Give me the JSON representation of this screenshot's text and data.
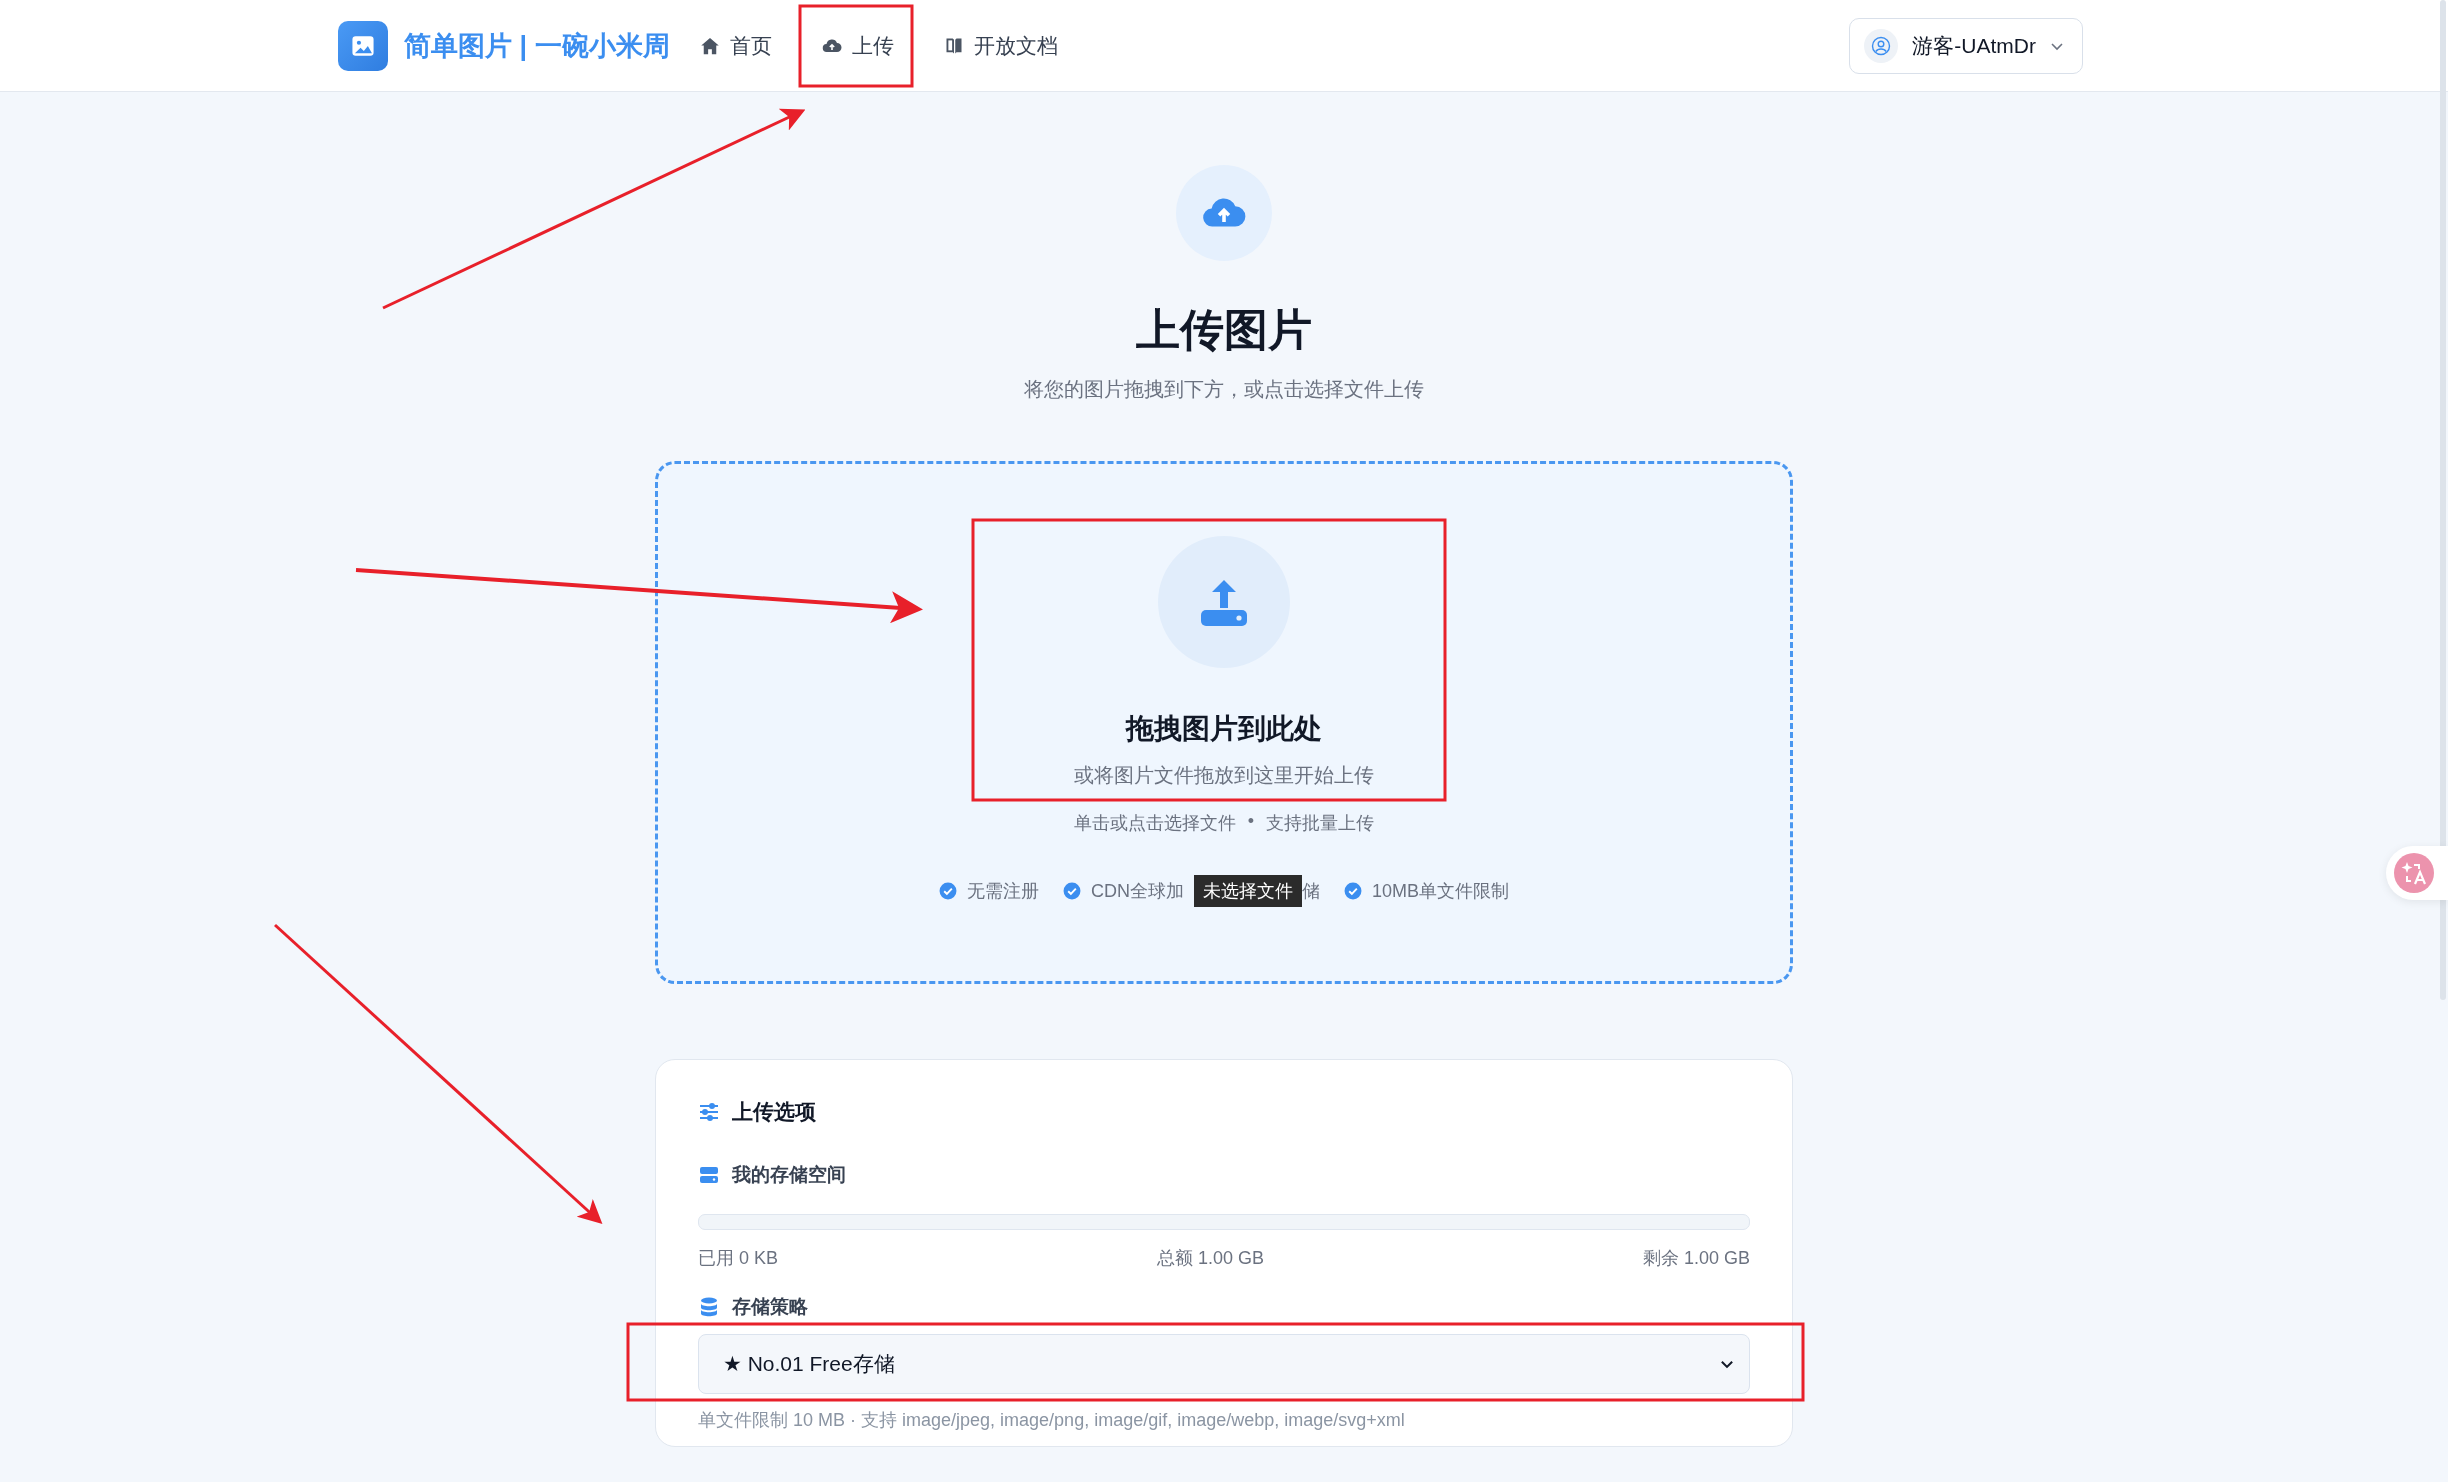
{
  "header": {
    "brand": "简单图片 | 一碗小米周",
    "nav": [
      {
        "label": "首页",
        "selected": false
      },
      {
        "label": "上传",
        "selected": false
      },
      {
        "label": "开放文档",
        "selected": false
      }
    ],
    "user": {
      "name": "游客-UAtmDr"
    }
  },
  "hero": {
    "title": "上传图片",
    "subtitle": "将您的图片拖拽到下方，或点击选择文件上传"
  },
  "dropzone": {
    "title": "拖拽图片到此处",
    "subtitle": "或将图片文件拖放到这里开始上传",
    "hint_left": "单击或点击选择文件",
    "separator": "•",
    "hint_right": "支持批量上传",
    "features": [
      {
        "text": "无需注册"
      },
      {
        "text": "CDN全球加",
        "tooltip": "未选择文件",
        "text_after": "储"
      },
      {
        "text": "10MB单文件限制"
      }
    ]
  },
  "options": {
    "title": "上传选项",
    "storage": {
      "label": "我的存储空间",
      "level": 0,
      "used": "已用 0 KB",
      "total": "总额 1.00 GB",
      "remaining": "剩余 1.00 GB"
    },
    "policy": {
      "label": "存储策略",
      "value": "★ No.01 Free存储",
      "hint": "单文件限制 10 MB · 支持 image/jpeg, image/png, image/gif, image/webp, image/svg+xml"
    }
  }
}
